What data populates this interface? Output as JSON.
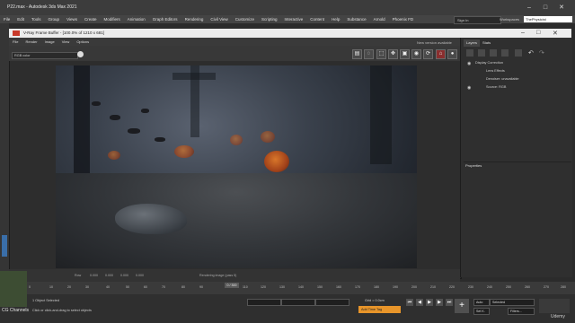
{
  "app": {
    "title": "P22.max - Autodesk 3ds Max 2021",
    "menu": [
      "File",
      "Edit",
      "Tools",
      "Group",
      "Views",
      "Create",
      "Modifiers",
      "Animation",
      "Graph Editors",
      "Rendering",
      "Civil View",
      "Customize",
      "Scripting",
      "Interactive",
      "Content",
      "Help",
      "Substance",
      "Arnold",
      "Phoenix FD"
    ],
    "sign_in": "Sign In",
    "workspaces_label": "Workspaces",
    "workspace_value": "ThePhysicist"
  },
  "vfb": {
    "title": "V-Ray Frame Buffer - [100.0% of 1210 x 681]",
    "menu": [
      "File",
      "Render",
      "Image",
      "View",
      "Options"
    ],
    "channel": "RGB color",
    "new_version": "New version available"
  },
  "panel": {
    "tabs": [
      "Layers",
      "Stats"
    ],
    "layers": [
      "Display Correction",
      "Lens Effects",
      "Denoiser: unavailable",
      "Source: RGB"
    ],
    "properties": "Properties"
  },
  "bottom": {
    "row_label": "Row",
    "values": [
      "0.000",
      "0.000",
      "0.000",
      "0.000"
    ],
    "status": "Rendering image (pass 5)"
  },
  "timeline": {
    "ticks": [
      "0",
      "10",
      "20",
      "30",
      "40",
      "50",
      "60",
      "70",
      "80",
      "90",
      "100",
      "110",
      "120",
      "130",
      "140",
      "150",
      "160",
      "170",
      "180",
      "190",
      "200",
      "210",
      "220",
      "230",
      "240",
      "250",
      "260",
      "270",
      "280",
      "290",
      "300"
    ],
    "current": "0 / 300"
  },
  "status": {
    "line1": "1 Object Selected",
    "line2": "Click or click-and-drag to select objects",
    "grid": "Grid = 0.0cm",
    "add_time_tag": "Add Time Tag",
    "selected": "Selected",
    "set_key": "Set K.",
    "filters": "Filters...",
    "auto": "Auto"
  },
  "watermark": "CG Channels",
  "brand": "Udemy",
  "colors": {
    "accent": "#e8952a",
    "window": "#3c3c3c",
    "vfb_title": "#ececec"
  }
}
